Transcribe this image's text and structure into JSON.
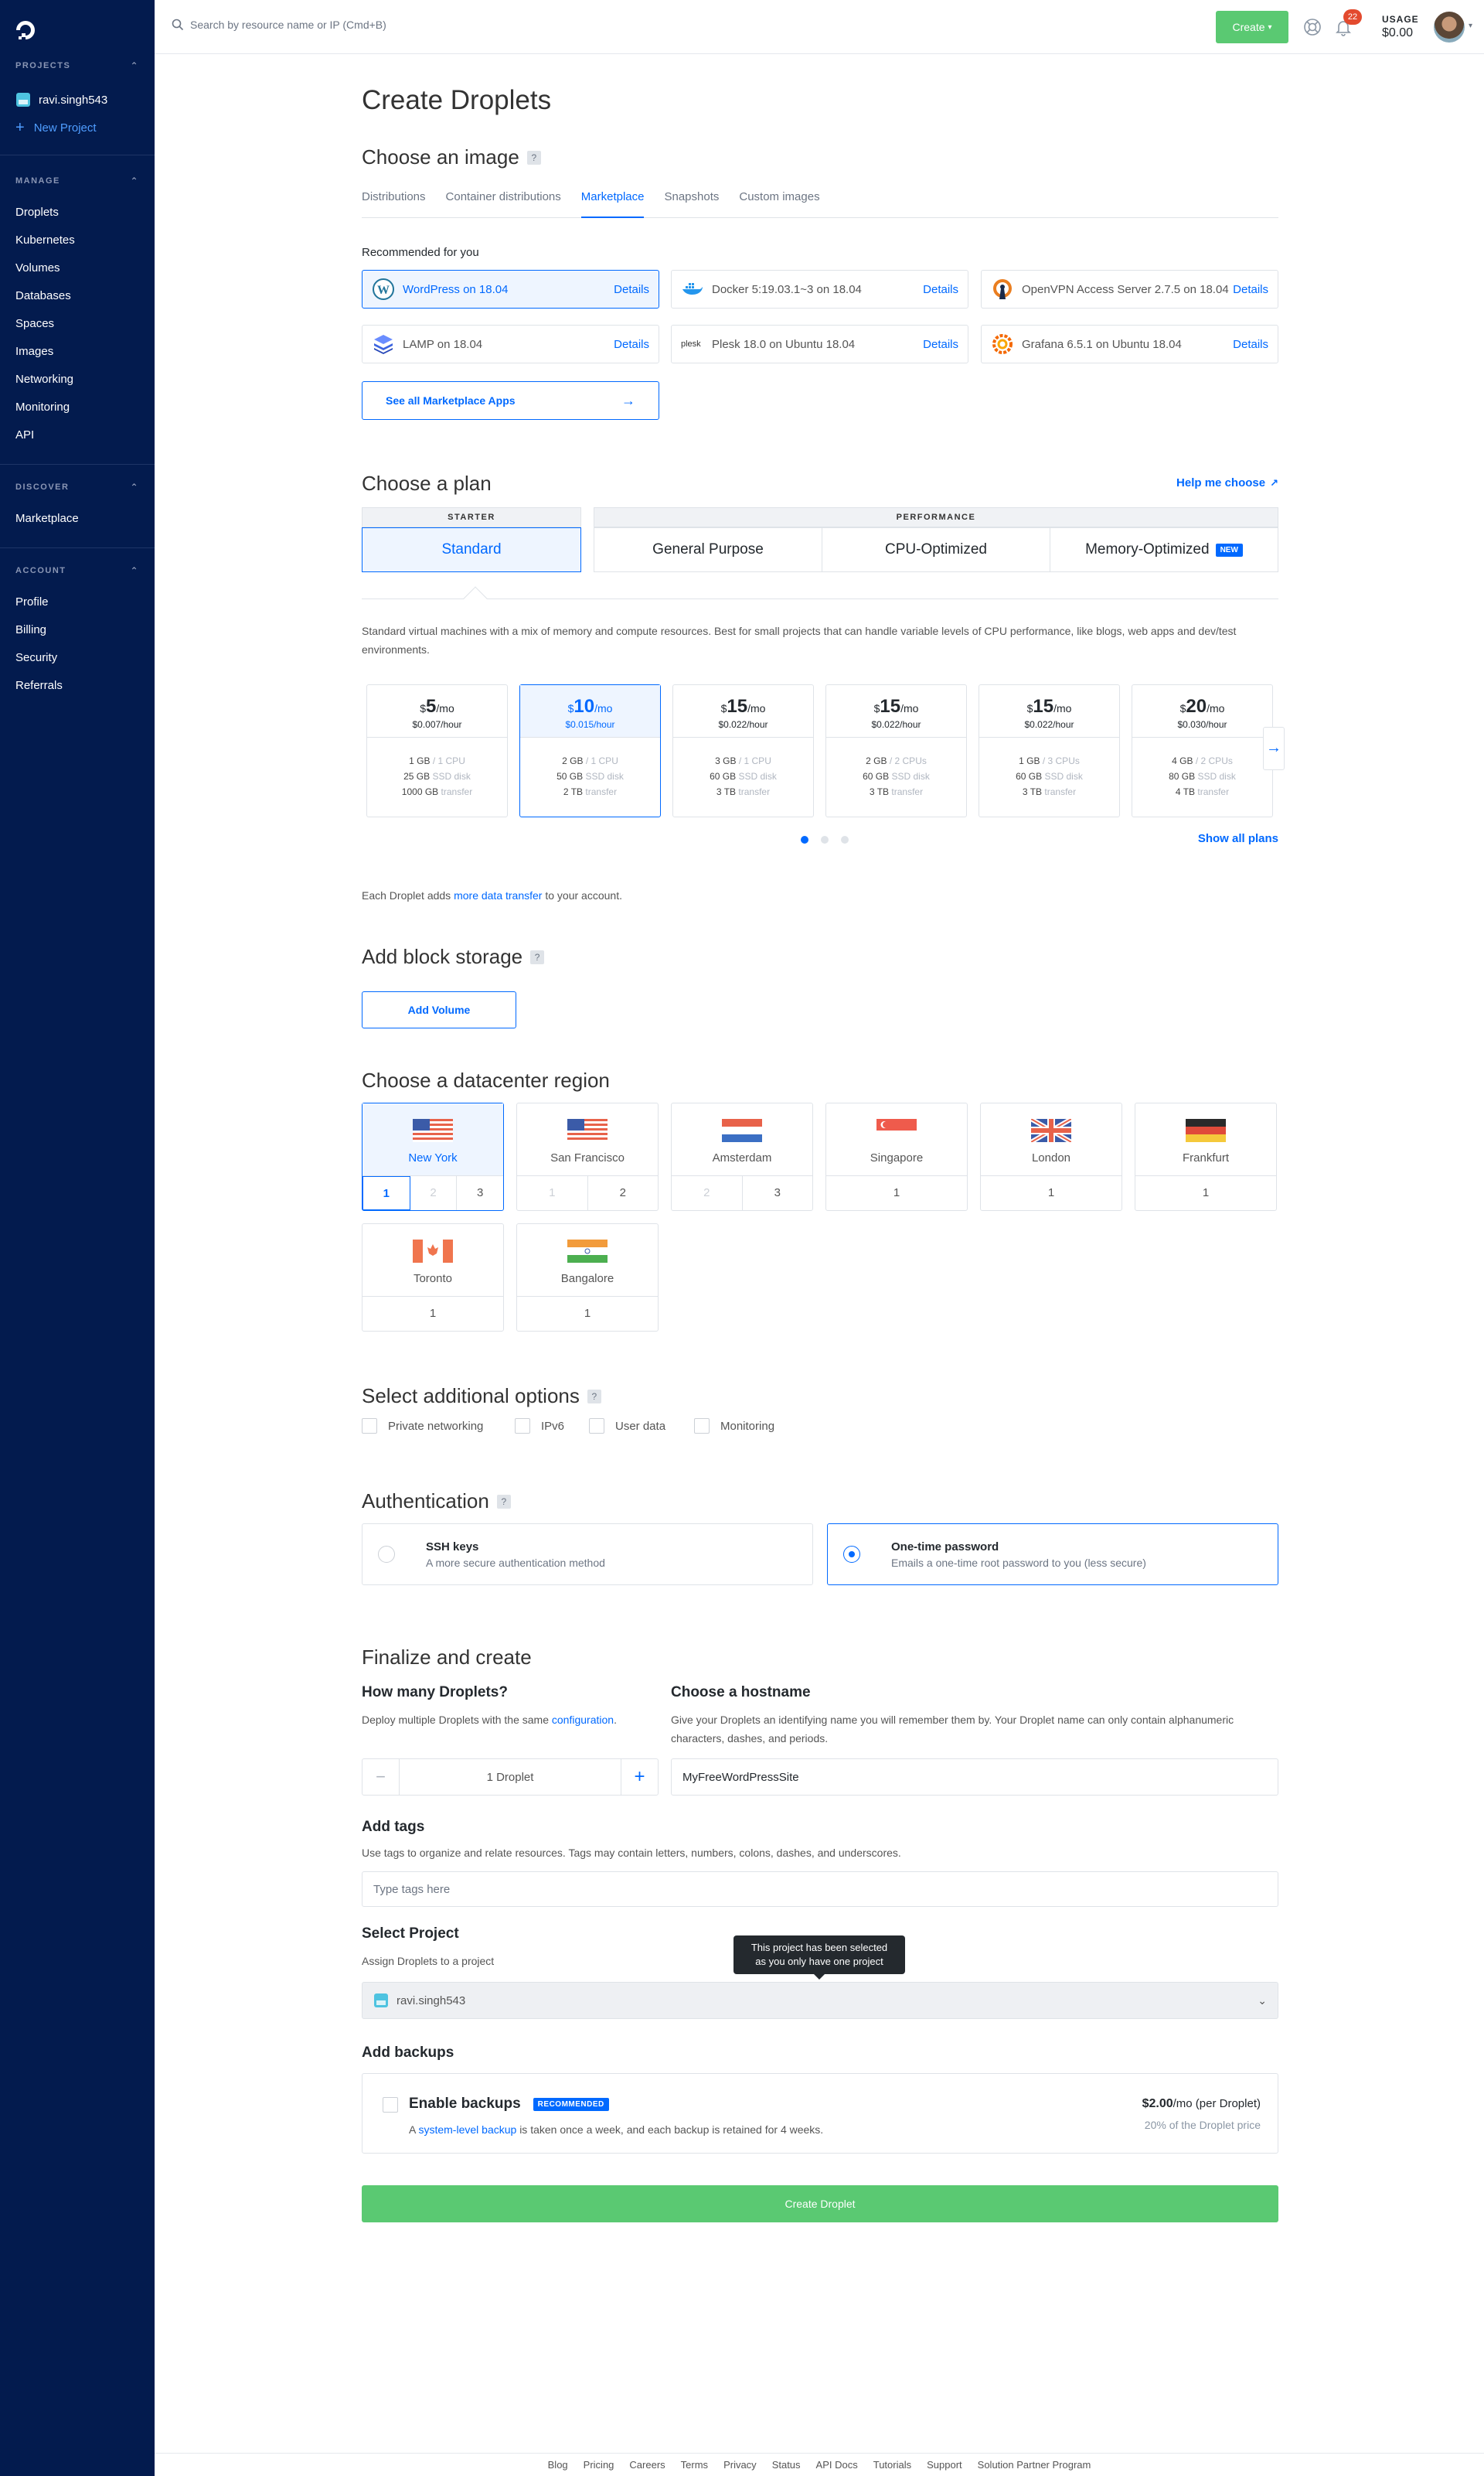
{
  "sidebar": {
    "sections": {
      "projects": "PROJECTS",
      "manage": "MANAGE",
      "discover": "DISCOVER",
      "account": "ACCOUNT"
    },
    "project_name": "ravi.singh543",
    "new_project": "New Project",
    "manage_items": [
      "Droplets",
      "Kubernetes",
      "Volumes",
      "Databases",
      "Spaces",
      "Images",
      "Networking",
      "Monitoring",
      "API"
    ],
    "discover_items": [
      "Marketplace"
    ],
    "account_items": [
      "Profile",
      "Billing",
      "Security",
      "Referrals"
    ]
  },
  "topbar": {
    "search_placeholder": "Search by resource name or IP (Cmd+B)",
    "create_label": "Create",
    "notifications_count": "22",
    "usage_label": "USAGE",
    "usage_value": "$0.00"
  },
  "page_title": "Create Droplets",
  "image": {
    "heading": "Choose an image",
    "tabs": [
      "Distributions",
      "Container distributions",
      "Marketplace",
      "Snapshots",
      "Custom images"
    ],
    "active_tab": "Marketplace",
    "recommended_label": "Recommended for you",
    "apps": [
      {
        "name": "WordPress on 18.04",
        "details": "Details",
        "selected": true
      },
      {
        "name": "Docker 5:19.03.1~3 on 18.04",
        "details": "Details"
      },
      {
        "name": "OpenVPN Access Server 2.7.5 on 18.04",
        "details": "Details"
      },
      {
        "name": "LAMP on 18.04",
        "details": "Details"
      },
      {
        "name": "Plesk 18.0 on Ubuntu 18.04",
        "details": "Details"
      },
      {
        "name": "Grafana 6.5.1 on Ubuntu 18.04",
        "details": "Details"
      }
    ],
    "see_all": "See all Marketplace Apps",
    "plesk_logo_text": "plesk"
  },
  "plan": {
    "heading": "Choose a plan",
    "help_link": "Help me choose",
    "starter_label": "STARTER",
    "performance_label": "PERFORMANCE",
    "tabs": [
      "Standard",
      "General Purpose",
      "CPU-Optimized",
      "Memory-Optimized"
    ],
    "new_badge": "NEW",
    "description": "Standard virtual machines with a mix of memory and compute resources. Best for small projects that can handle variable levels of CPU performance, like blogs, web apps and dev/test environments.",
    "cards": [
      {
        "currency": "$",
        "price": "5",
        "per": "/mo",
        "hourly": "$0.007/hour",
        "mem": "1 GB",
        "cpu": "/ 1 CPU",
        "disk": "25 GB",
        "disk_unit": "SSD disk",
        "transfer": "1000 GB",
        "transfer_unit": "transfer"
      },
      {
        "currency": "$",
        "price": "10",
        "per": "/mo",
        "hourly": "$0.015/hour",
        "mem": "2 GB",
        "cpu": "/ 1 CPU",
        "disk": "50 GB",
        "disk_unit": "SSD disk",
        "transfer": "2 TB",
        "transfer_unit": "transfer",
        "selected": true
      },
      {
        "currency": "$",
        "price": "15",
        "per": "/mo",
        "hourly": "$0.022/hour",
        "mem": "3 GB",
        "cpu": "/ 1 CPU",
        "disk": "60 GB",
        "disk_unit": "SSD disk",
        "transfer": "3 TB",
        "transfer_unit": "transfer"
      },
      {
        "currency": "$",
        "price": "15",
        "per": "/mo",
        "hourly": "$0.022/hour",
        "mem": "2 GB",
        "cpu": "/ 2 CPUs",
        "disk": "60 GB",
        "disk_unit": "SSD disk",
        "transfer": "3 TB",
        "transfer_unit": "transfer"
      },
      {
        "currency": "$",
        "price": "15",
        "per": "/mo",
        "hourly": "$0.022/hour",
        "mem": "1 GB",
        "cpu": "/ 3 CPUs",
        "disk": "60 GB",
        "disk_unit": "SSD disk",
        "transfer": "3 TB",
        "transfer_unit": "transfer"
      },
      {
        "currency": "$",
        "price": "20",
        "per": "/mo",
        "hourly": "$0.030/hour",
        "mem": "4 GB",
        "cpu": "/ 2 CPUs",
        "disk": "80 GB",
        "disk_unit": "SSD disk",
        "transfer": "4 TB",
        "transfer_unit": "transfer"
      }
    ],
    "show_all": "Show all plans",
    "transfer_note_pre": "Each Droplet adds",
    "transfer_note_link": "more data transfer",
    "transfer_note_post": "to your account."
  },
  "storage": {
    "heading": "Add block storage",
    "add_volume": "Add Volume"
  },
  "region": {
    "heading": "Choose a datacenter region",
    "regions": [
      {
        "name": "New York",
        "nums": [
          "1",
          "2",
          "3"
        ],
        "selected": true
      },
      {
        "name": "San Francisco",
        "nums": [
          "1",
          "2"
        ]
      },
      {
        "name": "Amsterdam",
        "nums": [
          "2",
          "3"
        ]
      },
      {
        "name": "Singapore",
        "nums": [
          "1"
        ]
      },
      {
        "name": "London",
        "nums": [
          "1"
        ]
      },
      {
        "name": "Frankfurt",
        "nums": [
          "1"
        ]
      },
      {
        "name": "Toronto",
        "nums": [
          "1"
        ]
      },
      {
        "name": "Bangalore",
        "nums": [
          "1"
        ]
      }
    ]
  },
  "options": {
    "heading": "Select additional options",
    "items": [
      "Private networking",
      "IPv6",
      "User data",
      "Monitoring"
    ]
  },
  "auth": {
    "heading": "Authentication",
    "ssh_title": "SSH keys",
    "ssh_sub": "A more secure authentication method",
    "otp_title": "One-time password",
    "otp_sub": "Emails a one-time root password to you (less secure)"
  },
  "finalize": {
    "heading": "Finalize and create",
    "count_heading": "How many Droplets?",
    "count_desc_pre": "Deploy multiple Droplets with the same",
    "count_desc_link": "configuration",
    "count_value": "1  Droplet",
    "hostname_heading": "Choose a hostname",
    "hostname_desc": "Give your Droplets an identifying name you will remember them by. Your Droplet name can only contain alphanumeric characters, dashes, and periods.",
    "hostname_value": "MyFreeWordPressSite",
    "tags_heading": "Add tags",
    "tags_desc": "Use tags to organize and relate resources. Tags may contain letters, numbers, colons, dashes, and underscores.",
    "tags_placeholder": "Type tags here",
    "project_heading": "Select Project",
    "project_desc": "Assign Droplets to a project",
    "project_value": "ravi.singh543",
    "tooltip_line1": "This project has been selected",
    "tooltip_line2": "as you only have one project",
    "backups_heading": "Add backups",
    "backup_title": "Enable backups",
    "backup_badge": "RECOMMENDED",
    "backup_sub_pre": "A",
    "backup_sub_link": "system-level backup",
    "backup_sub_post": "is taken once a week, and each backup is retained for 4 weeks.",
    "backup_price": "$2.00",
    "backup_price_suffix": "/mo (per Droplet)",
    "backup_pct": "20% of the Droplet price",
    "create_button": "Create Droplet"
  },
  "footer": [
    "Blog",
    "Pricing",
    "Careers",
    "Terms",
    "Privacy",
    "Status",
    "API Docs",
    "Tutorials",
    "Support",
    "Solution Partner Program"
  ],
  "colors": {
    "sidebar_bg": "#031b4e",
    "accent": "#0069ff",
    "create_green": "#5ac972",
    "badge_red": "#e34a2e"
  }
}
